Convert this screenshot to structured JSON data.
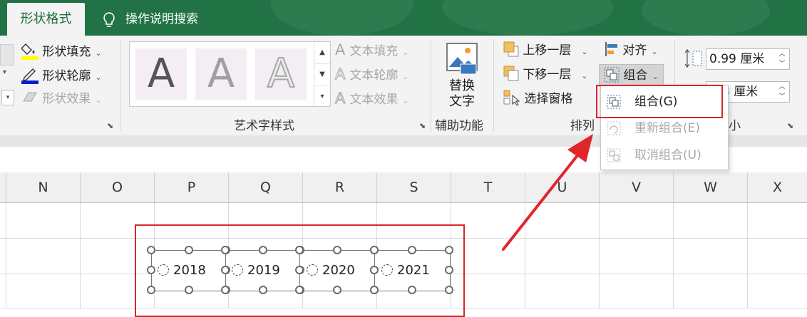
{
  "tabs": {
    "active": "形状格式",
    "search": "操作说明搜索"
  },
  "ribbon": {
    "shape_styles": {
      "fill": "形状填充",
      "outline": "形状轮廓",
      "effects": "形状效果"
    },
    "wordart": {
      "sample_glyph": "A",
      "text_fill": "文本填充",
      "text_outline": "文本轮廓",
      "text_effects": "文本效果",
      "group_label": "艺术字样式"
    },
    "accessibility": {
      "alt_text_line1": "替换",
      "alt_text_line2": "文字",
      "group_label": "辅助功能"
    },
    "arrange": {
      "bring_forward": "上移一层",
      "send_backward": "下移一层",
      "selection_pane": "选择窗格",
      "align": "对齐",
      "group": "组合",
      "group_label": "排列"
    },
    "size": {
      "height": "0.99 厘米",
      "width_visible": "8 厘米",
      "group_label_visible": "小"
    }
  },
  "group_menu": {
    "items": [
      {
        "label": "组合(G)",
        "enabled": true
      },
      {
        "label": "重新组合(E)",
        "enabled": false
      },
      {
        "label": "取消组合(U)",
        "enabled": false
      }
    ]
  },
  "columns": [
    "N",
    "O",
    "P",
    "Q",
    "R",
    "S",
    "T",
    "U",
    "V",
    "W",
    "X"
  ],
  "shapes": [
    {
      "label": "2018"
    },
    {
      "label": "2019"
    },
    {
      "label": "2020"
    },
    {
      "label": "2021"
    }
  ],
  "colors": {
    "brand": "#217346",
    "highlight": "#d9262c",
    "ribbon_bg": "#f3f3f3"
  }
}
